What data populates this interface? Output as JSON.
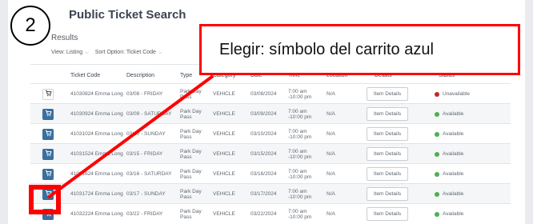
{
  "panel": {
    "title": "Public Ticket Search",
    "results_label": "Results",
    "view_label": "View: Listing",
    "sort_label": "Sort Option: Ticket Code"
  },
  "table": {
    "columns": [
      "Ticket Code",
      "Description",
      "Type",
      "Category",
      "Date",
      "Time",
      "Location",
      "Details",
      "Status"
    ],
    "rows": [
      {
        "code": "41030824 Emma Long",
        "description": "03/08 - FRIDAY",
        "type": "Park Day Pass",
        "category": "VEHICLE",
        "date": "03/08/2024",
        "time": "7:00 am -10:00 pm",
        "location": "N/A",
        "details_label": "Item Details",
        "status": "Unavailable",
        "cart": "gray"
      },
      {
        "code": "41030924 Emma Long",
        "description": "03/09 - SATURDAY",
        "type": "Park Day Pass",
        "category": "VEHICLE",
        "date": "03/09/2024",
        "time": "7:00 am -10:00 pm",
        "location": "N/A",
        "details_label": "Item Details",
        "status": "Available",
        "cart": "blue"
      },
      {
        "code": "41031024 Emma Long",
        "description": "03/10 - SUNDAY",
        "type": "Park Day Pass",
        "category": "VEHICLE",
        "date": "03/10/2024",
        "time": "7:00 am -10:00 pm",
        "location": "N/A",
        "details_label": "Item Details",
        "status": "Available",
        "cart": "blue"
      },
      {
        "code": "41031524 Emma Long",
        "description": "03/15 - FRIDAY",
        "type": "Park Day Pass",
        "category": "VEHICLE",
        "date": "03/15/2024",
        "time": "7:00 am -10:00 pm",
        "location": "N/A",
        "details_label": "Item Details",
        "status": "Available",
        "cart": "blue"
      },
      {
        "code": "41031624 Emma Long",
        "description": "03/16 - SATURDAY",
        "type": "Park Day Pass",
        "category": "VEHICLE",
        "date": "03/16/2024",
        "time": "7:00 am -10:00 pm",
        "location": "N/A",
        "details_label": "Item Details",
        "status": "Available",
        "cart": "blue"
      },
      {
        "code": "41031724 Emma Long",
        "description": "03/17 - SUNDAY",
        "type": "Park Day Pass",
        "category": "VEHICLE",
        "date": "03/17/2024",
        "time": "7:00 am -10:00 pm",
        "location": "N/A",
        "details_label": "Item Details",
        "status": "Available",
        "cart": "blue"
      },
      {
        "code": "41032224 Emma Long",
        "description": "03/22 - FRIDAY",
        "type": "Park Day Pass",
        "category": "VEHICLE",
        "date": "03/22/2024",
        "time": "7:00 am -10:00 pm",
        "location": "N/A",
        "details_label": "Item Details",
        "status": "Available",
        "cart": "blue"
      }
    ]
  },
  "annotation": {
    "step_number": "2",
    "callout_text": "Elegir: símbolo del carrito azul"
  },
  "colors": {
    "cart_blue": "#3b6f9e",
    "available_green": "#4caf50",
    "unavailable_red": "#c62828",
    "annotation_red": "#ff0000"
  }
}
